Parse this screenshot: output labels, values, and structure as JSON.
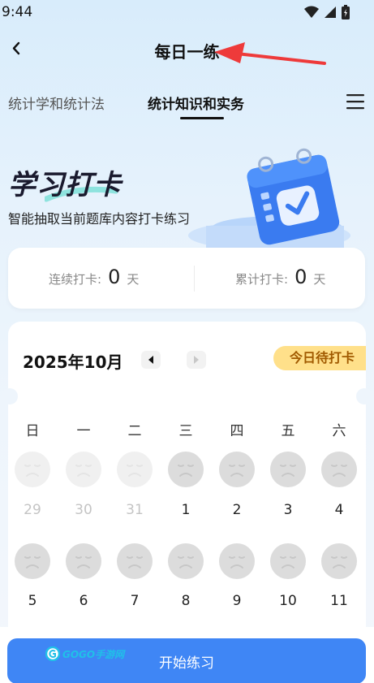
{
  "status_bar": {
    "time": "9:44"
  },
  "nav": {
    "title": "每日一练"
  },
  "tabs": [
    {
      "label": "统计学和统计法"
    },
    {
      "label": "统计知识和实务"
    }
  ],
  "hero": {
    "title": "学习打卡",
    "subtitle": "智能抽取当前题库内容打卡练习"
  },
  "stats": {
    "streak_label": "连续打卡:",
    "streak_value": "0",
    "streak_unit": "天",
    "total_label": "累计打卡:",
    "total_value": "0",
    "total_unit": "天"
  },
  "calendar": {
    "month": "2025年10月",
    "today_badge": "今日待打卡",
    "weekdays": [
      "日",
      "一",
      "二",
      "三",
      "四",
      "五",
      "六"
    ],
    "row1": [
      "29",
      "30",
      "31",
      "1",
      "2",
      "3",
      "4"
    ],
    "row2": [
      "5",
      "6",
      "7",
      "8",
      "9",
      "10",
      "11"
    ]
  },
  "footer": {
    "start_button": "开始练习",
    "watermark": "GOGO手游网"
  },
  "colors": {
    "accent": "#3f86f5",
    "badge_bg": "#ffe08a",
    "badge_text": "#a15a00",
    "annotation": "#ee3a3a"
  }
}
